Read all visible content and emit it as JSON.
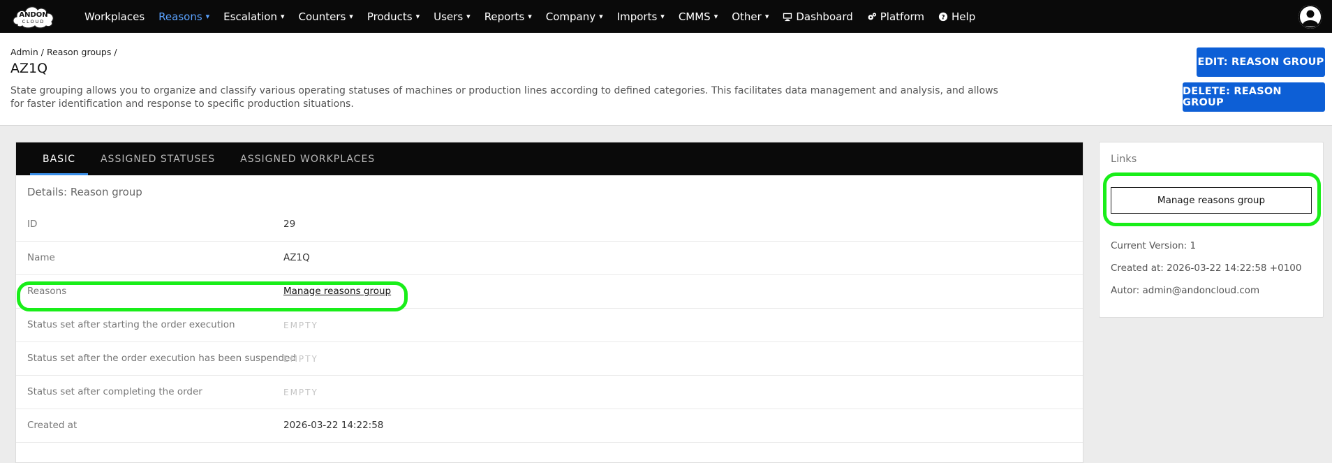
{
  "brand": {
    "logo_text_top": "ANDON",
    "logo_text_bottom": "CLOUD"
  },
  "nav": {
    "items": [
      {
        "label": "Workplaces",
        "caret": "",
        "active": false
      },
      {
        "label": "Reasons",
        "caret": "▾",
        "active": true
      },
      {
        "label": "Escalation",
        "caret": "▾",
        "active": false
      },
      {
        "label": "Counters",
        "caret": "▾",
        "active": false
      },
      {
        "label": "Products",
        "caret": "▾",
        "active": false
      },
      {
        "label": "Users",
        "caret": "▾",
        "active": false
      },
      {
        "label": "Reports",
        "caret": "▾",
        "active": false
      },
      {
        "label": "Company",
        "caret": "▾",
        "active": false
      },
      {
        "label": "Imports",
        "caret": "▾",
        "active": false
      },
      {
        "label": "CMMS",
        "caret": "▾",
        "active": false
      },
      {
        "label": "Other",
        "caret": "▾",
        "active": false
      }
    ],
    "dashboard_label": "Dashboard",
    "platform_label": "Platform",
    "help_label": "Help",
    "active_color": "#5aa2ff"
  },
  "header": {
    "breadcrumb": "Admin / Reason groups /",
    "title": "AZ1Q",
    "description": "State grouping allows you to organize and classify various operating statuses of machines or production lines according to defined categories. This facilitates data management and analysis, and allows for faster identification and response to specific production situations.",
    "edit_button": "EDIT: REASON GROUP",
    "delete_button": "DELETE: REASON GROUP",
    "button_color": "#0d5fd6"
  },
  "tabs": [
    {
      "label": "BASIC",
      "active": true
    },
    {
      "label": "ASSIGNED STATUSES",
      "active": false
    },
    {
      "label": "ASSIGNED WORKPLACES",
      "active": false
    }
  ],
  "details": {
    "subtitle": "Details: Reason group",
    "rows": [
      {
        "label": "ID",
        "value": "29"
      },
      {
        "label": "Name",
        "value": "AZ1Q"
      },
      {
        "label": "Reasons",
        "value": "Manage reasons group"
      },
      {
        "label": "Status set after starting the order execution",
        "value": "EMPTY"
      },
      {
        "label": "Status set after the order execution has been suspended",
        "value": "EMPTY"
      },
      {
        "label": "Status set after completing the order",
        "value": "EMPTY"
      },
      {
        "label": "Created at",
        "value": "2026-03-22 14:22:58"
      }
    ]
  },
  "links": {
    "title": "Links",
    "manage_button": "Manage reasons group",
    "current_version": "Current Version: 1",
    "created_at": "Created at: 2026-03-22 14:22:58 +0100",
    "author": "Autor: admin@andoncloud.com"
  },
  "highlight_color": "#19ee19"
}
